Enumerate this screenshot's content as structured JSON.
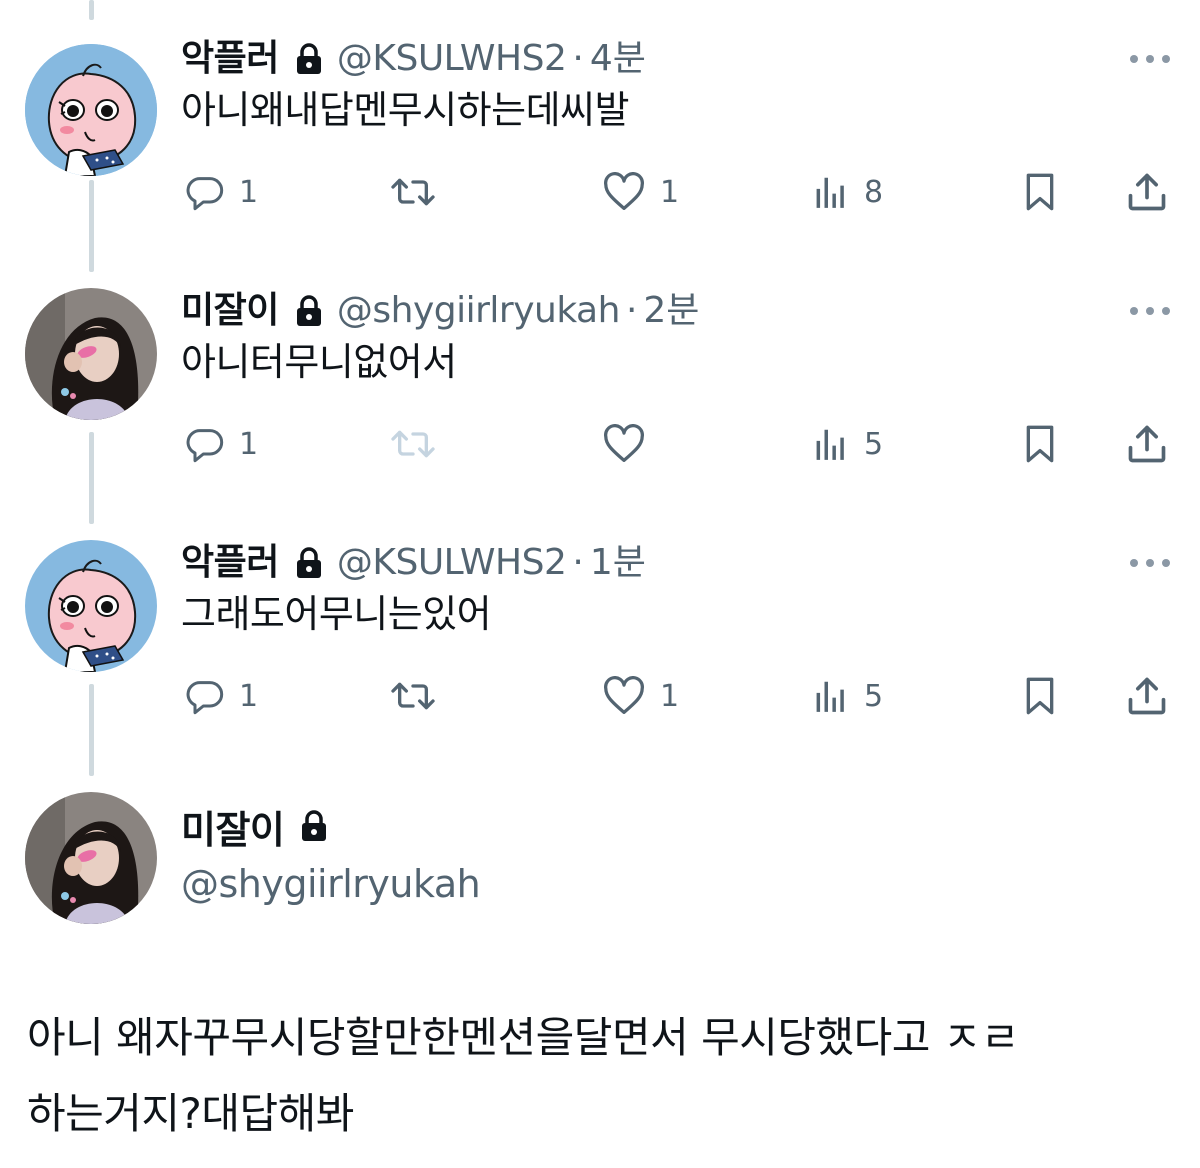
{
  "thread": [
    {
      "display_name": "악플러",
      "handle": "@KSULWHS2",
      "separator": "·",
      "time": "4분",
      "text": "아니왜내답멘무시하는데씨발",
      "avatar": "peach-character",
      "replies": "1",
      "retweets": "",
      "likes": "1",
      "views": "8",
      "retweet_disabled": false
    },
    {
      "display_name": "미잘이",
      "handle": "@shygiirlryukah",
      "separator": "·",
      "time": "2분",
      "text": "아니터무니없어서",
      "avatar": "girl-photo",
      "replies": "1",
      "retweets": "",
      "likes": "",
      "views": "5",
      "retweet_disabled": true
    },
    {
      "display_name": "악플러",
      "handle": "@KSULWHS2",
      "separator": "·",
      "time": "1분",
      "text": "그래도어무니는있어",
      "avatar": "peach-character",
      "replies": "1",
      "retweets": "",
      "likes": "1",
      "views": "5",
      "retweet_disabled": false
    }
  ],
  "main_tweet": {
    "display_name": "미잘이",
    "handle": "@shygiirlryukah",
    "text_line1": "아니 왜자꾸무시당할만한멘션을달면서 무시당했다고 ㅈㄹ",
    "text_line2": "하는거지?대답해봐"
  },
  "icons": {
    "more": "more-horizontal-icon",
    "lock": "lock-icon",
    "reply": "reply-icon",
    "retweet": "retweet-icon",
    "like": "heart-icon",
    "views": "views-chart-icon",
    "bookmark": "bookmark-icon",
    "share": "share-icon"
  },
  "colors": {
    "text": "#0f1419",
    "secondary": "#536471",
    "thread_line": "#cfd9de",
    "disabled_icon": "#c5d4e0"
  }
}
